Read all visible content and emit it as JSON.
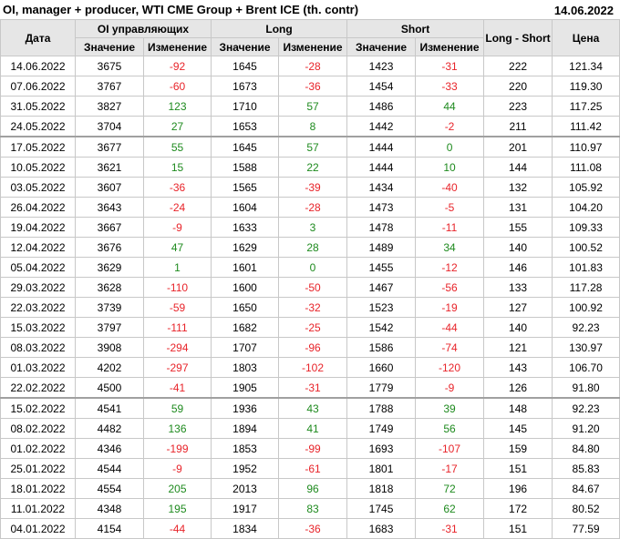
{
  "title": "OI, manager + producer, WTI CME Group + Brent ICE (th. contr)",
  "date": "14.06.2022",
  "headers": {
    "date": "Дата",
    "oi_group": "OI управляющих",
    "long_group": "Long",
    "short_group": "Short",
    "long_short": "Long - Short",
    "price": "Цена",
    "value": "Значение",
    "change": "Изменение"
  },
  "colors": {
    "positive": "#1e8a1e",
    "negative": "#e8242a",
    "header_bg": "#e6e6e6"
  },
  "rows": [
    {
      "date": "14.06.2022",
      "oi": "3675",
      "oi_ch": "-92",
      "long": "1645",
      "long_ch": "-28",
      "short": "1423",
      "short_ch": "-31",
      "ls": "222",
      "price": "121.34"
    },
    {
      "date": "07.06.2022",
      "oi": "3767",
      "oi_ch": "-60",
      "long": "1673",
      "long_ch": "-36",
      "short": "1454",
      "short_ch": "-33",
      "ls": "220",
      "price": "119.30"
    },
    {
      "date": "31.05.2022",
      "oi": "3827",
      "oi_ch": "123",
      "long": "1710",
      "long_ch": "57",
      "short": "1486",
      "short_ch": "44",
      "ls": "223",
      "price": "117.25"
    },
    {
      "date": "24.05.2022",
      "oi": "3704",
      "oi_ch": "27",
      "long": "1653",
      "long_ch": "8",
      "short": "1442",
      "short_ch": "-2",
      "ls": "211",
      "price": "111.42"
    },
    {
      "date": "17.05.2022",
      "oi": "3677",
      "oi_ch": "55",
      "long": "1645",
      "long_ch": "57",
      "short": "1444",
      "short_ch": "0",
      "ls": "201",
      "price": "110.97"
    },
    {
      "date": "10.05.2022",
      "oi": "3621",
      "oi_ch": "15",
      "long": "1588",
      "long_ch": "22",
      "short": "1444",
      "short_ch": "10",
      "ls": "144",
      "price": "111.08"
    },
    {
      "date": "03.05.2022",
      "oi": "3607",
      "oi_ch": "-36",
      "long": "1565",
      "long_ch": "-39",
      "short": "1434",
      "short_ch": "-40",
      "ls": "132",
      "price": "105.92"
    },
    {
      "date": "26.04.2022",
      "oi": "3643",
      "oi_ch": "-24",
      "long": "1604",
      "long_ch": "-28",
      "short": "1473",
      "short_ch": "-5",
      "ls": "131",
      "price": "104.20"
    },
    {
      "date": "19.04.2022",
      "oi": "3667",
      "oi_ch": "-9",
      "long": "1633",
      "long_ch": "3",
      "short": "1478",
      "short_ch": "-11",
      "ls": "155",
      "price": "109.33"
    },
    {
      "date": "12.04.2022",
      "oi": "3676",
      "oi_ch": "47",
      "long": "1629",
      "long_ch": "28",
      "short": "1489",
      "short_ch": "34",
      "ls": "140",
      "price": "100.52"
    },
    {
      "date": "05.04.2022",
      "oi": "3629",
      "oi_ch": "1",
      "long": "1601",
      "long_ch": "0",
      "short": "1455",
      "short_ch": "-12",
      "ls": "146",
      "price": "101.83"
    },
    {
      "date": "29.03.2022",
      "oi": "3628",
      "oi_ch": "-110",
      "long": "1600",
      "long_ch": "-50",
      "short": "1467",
      "short_ch": "-56",
      "ls": "133",
      "price": "117.28"
    },
    {
      "date": "22.03.2022",
      "oi": "3739",
      "oi_ch": "-59",
      "long": "1650",
      "long_ch": "-32",
      "short": "1523",
      "short_ch": "-19",
      "ls": "127",
      "price": "100.92"
    },
    {
      "date": "15.03.2022",
      "oi": "3797",
      "oi_ch": "-111",
      "long": "1682",
      "long_ch": "-25",
      "short": "1542",
      "short_ch": "-44",
      "ls": "140",
      "price": "92.23"
    },
    {
      "date": "08.03.2022",
      "oi": "3908",
      "oi_ch": "-294",
      "long": "1707",
      "long_ch": "-96",
      "short": "1586",
      "short_ch": "-74",
      "ls": "121",
      "price": "130.97"
    },
    {
      "date": "01.03.2022",
      "oi": "4202",
      "oi_ch": "-297",
      "long": "1803",
      "long_ch": "-102",
      "short": "1660",
      "short_ch": "-120",
      "ls": "143",
      "price": "106.70"
    },
    {
      "date": "22.02.2022",
      "oi": "4500",
      "oi_ch": "-41",
      "long": "1905",
      "long_ch": "-31",
      "short": "1779",
      "short_ch": "-9",
      "ls": "126",
      "price": "91.80"
    },
    {
      "date": "15.02.2022",
      "oi": "4541",
      "oi_ch": "59",
      "long": "1936",
      "long_ch": "43",
      "short": "1788",
      "short_ch": "39",
      "ls": "148",
      "price": "92.23"
    },
    {
      "date": "08.02.2022",
      "oi": "4482",
      "oi_ch": "136",
      "long": "1894",
      "long_ch": "41",
      "short": "1749",
      "short_ch": "56",
      "ls": "145",
      "price": "91.20"
    },
    {
      "date": "01.02.2022",
      "oi": "4346",
      "oi_ch": "-199",
      "long": "1853",
      "long_ch": "-99",
      "short": "1693",
      "short_ch": "-107",
      "ls": "159",
      "price": "84.80"
    },
    {
      "date": "25.01.2022",
      "oi": "4544",
      "oi_ch": "-9",
      "long": "1952",
      "long_ch": "-61",
      "short": "1801",
      "short_ch": "-17",
      "ls": "151",
      "price": "85.83"
    },
    {
      "date": "18.01.2022",
      "oi": "4554",
      "oi_ch": "205",
      "long": "2013",
      "long_ch": "96",
      "short": "1818",
      "short_ch": "72",
      "ls": "196",
      "price": "84.67"
    },
    {
      "date": "11.01.2022",
      "oi": "4348",
      "oi_ch": "195",
      "long": "1917",
      "long_ch": "83",
      "short": "1745",
      "short_ch": "62",
      "ls": "172",
      "price": "80.52"
    },
    {
      "date": "04.01.2022",
      "oi": "4154",
      "oi_ch": "-44",
      "long": "1834",
      "long_ch": "-36",
      "short": "1683",
      "short_ch": "-31",
      "ls": "151",
      "price": "77.59"
    }
  ],
  "separators_before_rows": [
    4,
    17
  ]
}
